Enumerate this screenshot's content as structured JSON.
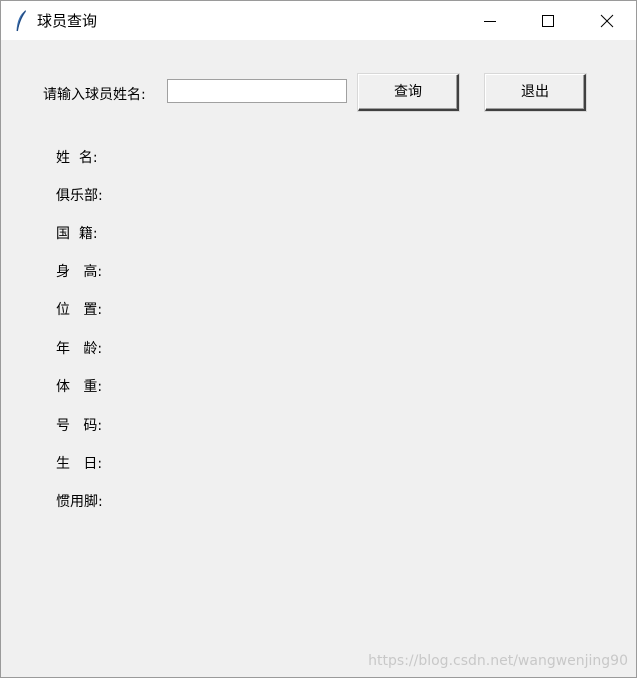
{
  "window": {
    "title": "球员查询",
    "controls": {
      "minimize": "minimize-icon",
      "maximize": "maximize-icon",
      "close": "close-icon"
    }
  },
  "search": {
    "label": "请输入球员姓名:",
    "value": "",
    "query_button": "查询",
    "exit_button": "退出"
  },
  "fields": [
    {
      "label": "姓  名:"
    },
    {
      "label": "俱乐部:"
    },
    {
      "label": "国  籍:"
    },
    {
      "label": "身   高:"
    },
    {
      "label": "位   置:"
    },
    {
      "label": "年   龄:"
    },
    {
      "label": "体   重:"
    },
    {
      "label": "号   码:"
    },
    {
      "label": "生   日:"
    },
    {
      "label": "惯用脚:"
    }
  ],
  "watermark": "https://blog.csdn.net/wangwenjing90",
  "colors": {
    "background": "#f0f0f0",
    "titlebar": "#ffffff"
  }
}
